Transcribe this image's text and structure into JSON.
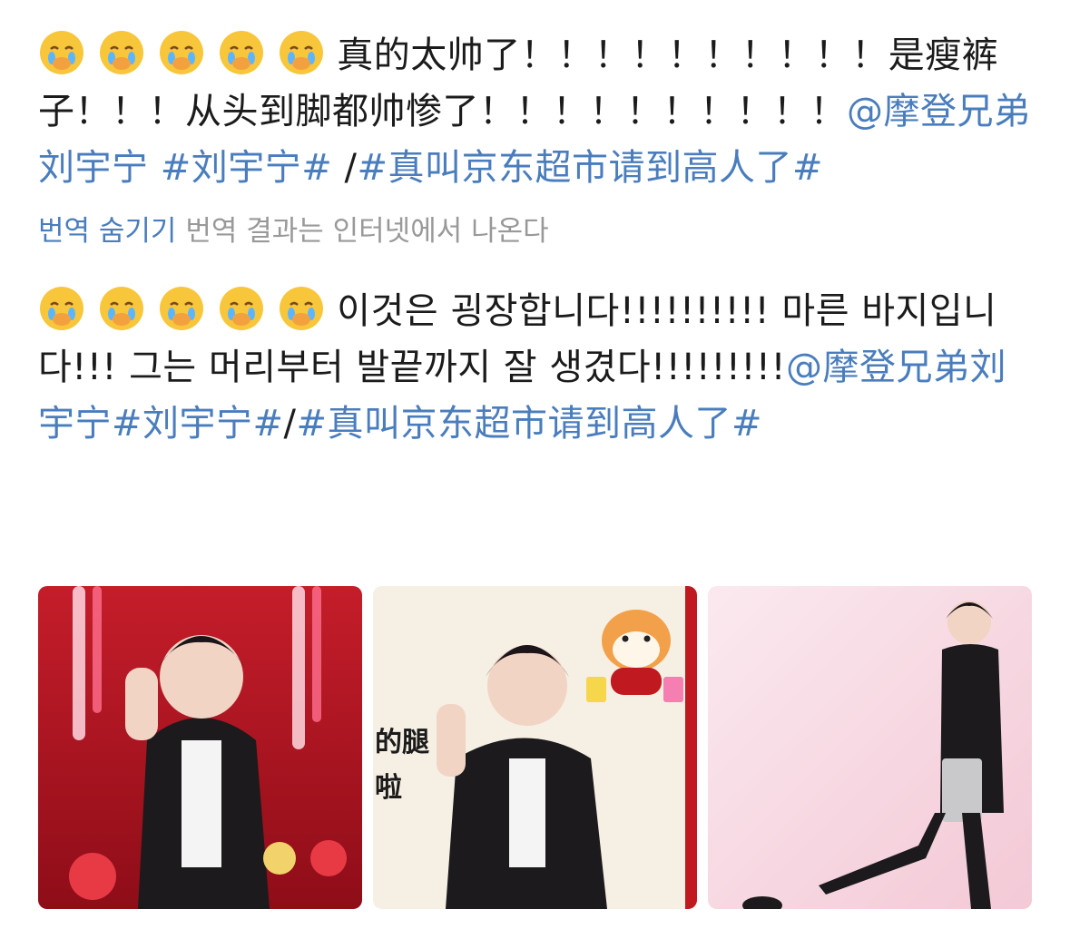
{
  "post": {
    "original": {
      "segments": [
        {
          "text": "真的太帅了！！！！！！！！！！是瘦裤子！！！从头到脚都帅惨了！！！！！！！！！！",
          "link": false
        },
        {
          "text": "@摩登兄弟刘宇宁",
          "link": true
        },
        {
          "text": " ",
          "link": false
        },
        {
          "text": "#刘宇宁#",
          "link": true
        },
        {
          "text": " /",
          "link": false
        },
        {
          "text": "#真叫京东超市请到高人了#",
          "link": true
        }
      ]
    },
    "translation_bar": {
      "hide_label": "번역 숨기기",
      "source_note": "번역 결과는 인터넷에서 나온다"
    },
    "translated": {
      "segments": [
        {
          "text": "이것은 굉장합니다!!!!!!!!!! 마른 바지입니다!!! 그는 머리부터 발끝까지 잘 생겼다!!!!!!!!!",
          "link": false
        },
        {
          "text": "@摩登兄弟刘宇宁",
          "link": true
        },
        {
          "text": "#刘宇宁#",
          "link": true
        },
        {
          "text": "/",
          "link": false
        },
        {
          "text": "#真叫京东超市请到高人了#",
          "link": true
        }
      ]
    },
    "emoji_name": "covering-mouth-crying-emoji",
    "emoji_count": 5,
    "images": [
      {
        "name": "photo-red-stage",
        "overlay_text": ""
      },
      {
        "name": "photo-dog-sticker",
        "overlay_text": "的腿\n啦"
      },
      {
        "name": "photo-pink-pose",
        "overlay_text": ""
      }
    ],
    "colors": {
      "link": "#4a7dbd",
      "text": "#1b1b1b",
      "muted": "#999999"
    }
  }
}
